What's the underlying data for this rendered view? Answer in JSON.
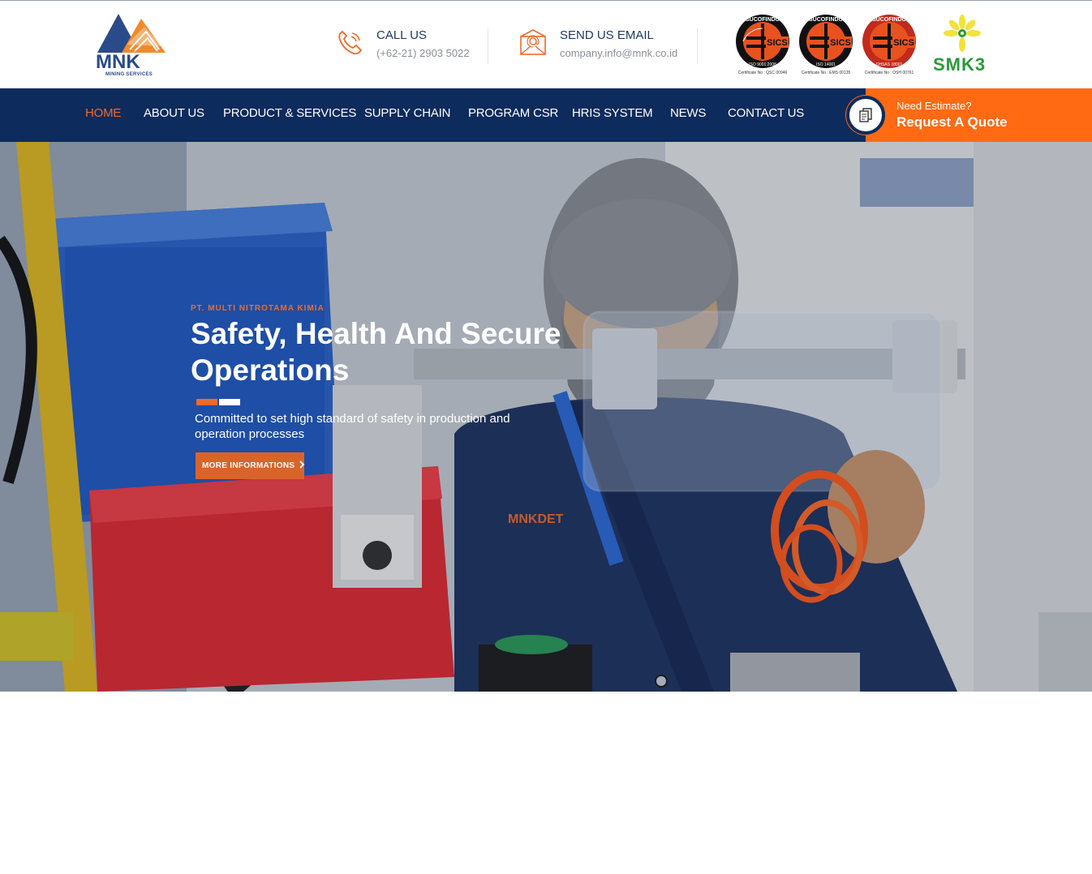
{
  "brand": {
    "name": "MNK",
    "tagline": "MINING SERVICES",
    "colors": {
      "navy": "#0d2b5c",
      "orange": "#ef6a2a",
      "quote_bg": "#ff6a13"
    }
  },
  "header": {
    "call": {
      "icon": "phone-icon",
      "title": "CALL US",
      "value": "(+62-21) 2903 5022"
    },
    "email": {
      "icon": "mail-icon",
      "title": "SEND US EMAIL",
      "value": "company.info@mnk.co.id"
    },
    "certifications": [
      {
        "brand": "SUCOFINDO",
        "mark": "SICS",
        "standard": "ISO 9001:2008",
        "caption": "Certificate No : QSC 00946"
      },
      {
        "brand": "SUCOFINDO",
        "mark": "SICS",
        "standard": "ISO 14001",
        "caption": "Certificate No : EMS 00135"
      },
      {
        "brand": "SUCOFINDO",
        "mark": "SICS",
        "standard": "OHSAS 18001",
        "caption": "Certificate No : OSH 00761"
      }
    ],
    "smk3": "SMK3"
  },
  "nav": {
    "items": [
      "HOME",
      "ABOUT US",
      "PRODUCT & SERVICES",
      "SUPPLY CHAIN",
      "PROGRAM CSR",
      "HRIS SYSTEM",
      "NEWS",
      "CONTACT US"
    ],
    "active": "HOME",
    "quote": {
      "icon": "document-copy-icon",
      "small": "Need Estimate?",
      "big": "Request A Quote"
    }
  },
  "hero": {
    "eyebrow": "PT. MULTI NITROTAMA KIMIA",
    "title": "Safety, Health And Secure Operations",
    "subtitle": "Committed to set high standard of safety in production and operation processes",
    "button": "MORE INFORMATIONS",
    "button_icon": "chevron-right-icon",
    "shirt_logo": "MNKDET"
  }
}
